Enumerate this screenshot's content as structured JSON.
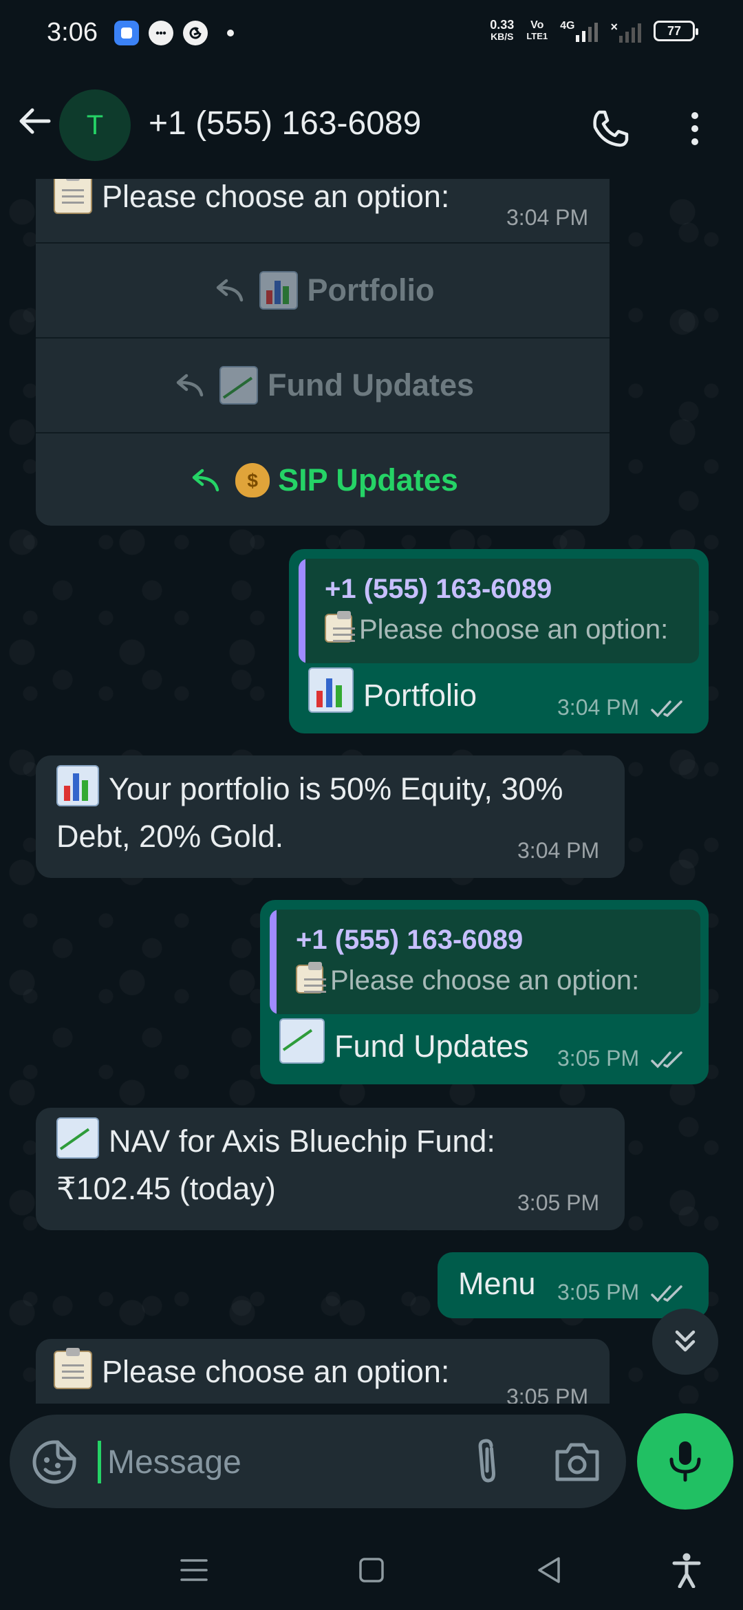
{
  "status_bar": {
    "time": "3:06",
    "net_speed_value": "0.33",
    "net_speed_unit": "KB/S",
    "volte_top": "Vo",
    "volte_bottom": "LTE1",
    "network": "4G",
    "battery": "77"
  },
  "header": {
    "avatar_letter": "T",
    "contact_name": "+1 (555) 163-6089"
  },
  "messages": {
    "m1": {
      "text": "Please choose an option:",
      "time": "3:04 PM",
      "options": [
        "Portfolio",
        "Fund Updates",
        "SIP Updates"
      ]
    },
    "m2": {
      "quote_name": "+1 (555) 163-6089",
      "quote_text": "Please choose an option:",
      "text": "Portfolio",
      "time": "3:04 PM"
    },
    "m3": {
      "line1": "Your portfolio is 50% Equity, 30%",
      "line2": "Debt, 20% Gold.",
      "time": "3:04 PM"
    },
    "m4": {
      "quote_name": "+1 (555) 163-6089",
      "quote_text": "Please choose an option:",
      "text": "Fund Updates",
      "time": "3:05 PM"
    },
    "m5": {
      "line1": "NAV for Axis Bluechip Fund:",
      "line2": "₹102.45 (today)",
      "time": "3:05 PM"
    },
    "m6": {
      "text": "Menu",
      "time": "3:05 PM"
    },
    "m7": {
      "text": "Please choose an option:",
      "time": "3:05 PM"
    }
  },
  "composer": {
    "placeholder": "Message"
  },
  "colors": {
    "accent": "#25d366",
    "outgoing_bubble": "#005c4b",
    "incoming_bubble": "#202c33",
    "background": "#0b141a"
  },
  "icons": {
    "back": "arrow-left-icon",
    "call": "phone-icon",
    "more": "more-vertical-icon",
    "sticker": "sticker-icon",
    "attach": "paperclip-icon",
    "camera": "camera-icon",
    "mic": "mic-icon",
    "scroll": "chevrons-down-icon"
  }
}
